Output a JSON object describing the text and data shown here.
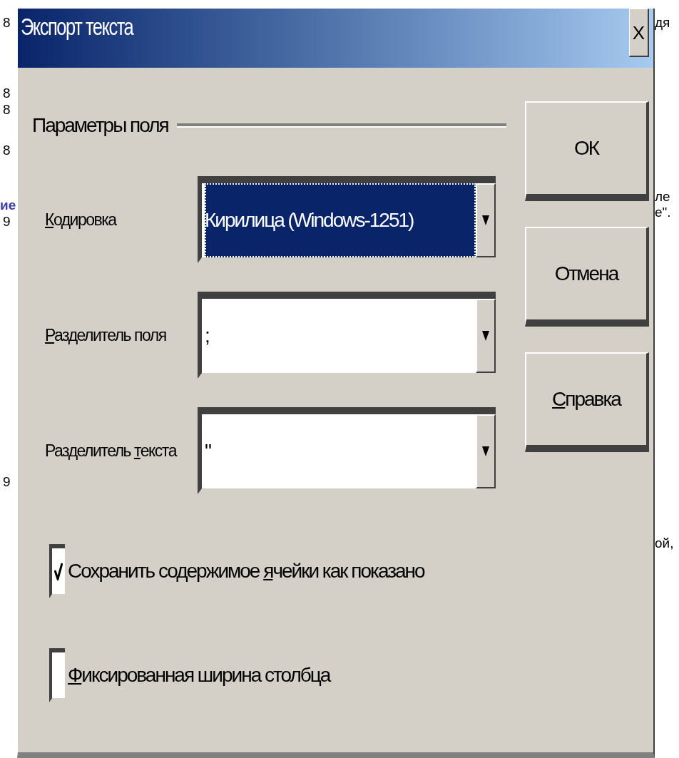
{
  "background_text": {
    "left": [
      {
        "text": "8",
        "kind": "plain"
      },
      {
        "text": "8",
        "kind": "plain"
      },
      {
        "text": "8",
        "kind": "plain"
      },
      {
        "text": "8",
        "kind": "plain"
      },
      {
        "text": "ие",
        "kind": "heading"
      },
      {
        "text": "9",
        "kind": "plain"
      },
      {
        "text": "9",
        "kind": "plain"
      }
    ],
    "right": [
      {
        "text": "дя"
      },
      {
        "text": "ле"
      },
      {
        "text": "е\"."
      },
      {
        "text": "ой,"
      }
    ]
  },
  "window": {
    "title": "Экспорт текста",
    "close": "X"
  },
  "group": {
    "title": "Параметры поля"
  },
  "fields": [
    {
      "label": [
        {
          "text": "К",
          "underline": true
        },
        {
          "text": "одировка",
          "underline": false
        }
      ],
      "value": "Кирилица (Windows-1251)",
      "selected": true
    },
    {
      "label": [
        {
          "text": "Р",
          "underline": true
        },
        {
          "text": "азделитель поля",
          "underline": false
        }
      ],
      "value": ";",
      "selected": false
    },
    {
      "label": [
        {
          "text": "Разделитель ",
          "underline": false
        },
        {
          "text": "т",
          "underline": true
        },
        {
          "text": "екста",
          "underline": false
        }
      ],
      "value": "\"",
      "selected": false
    }
  ],
  "buttons": [
    {
      "label": [
        {
          "text": "ОК",
          "underline": false
        }
      ]
    },
    {
      "label": [
        {
          "text": "Отмена",
          "underline": false
        }
      ]
    },
    {
      "label": [
        {
          "text": "С",
          "underline": true
        },
        {
          "text": "правка",
          "underline": false
        }
      ]
    }
  ],
  "checkboxes": [
    {
      "label": [
        {
          "text": "Сохранить содержимое ",
          "underline": false
        },
        {
          "text": "я",
          "underline": true
        },
        {
          "text": "чейки как показано",
          "underline": false
        }
      ],
      "checked": true
    },
    {
      "label": [
        {
          "text": "Ф",
          "underline": true
        },
        {
          "text": "иксированная ширина столбца",
          "underline": false
        }
      ],
      "checked": false
    }
  ]
}
